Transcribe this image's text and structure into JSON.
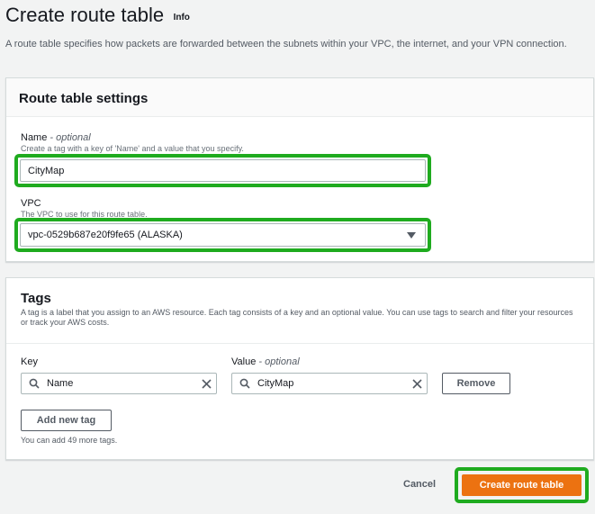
{
  "header": {
    "title": "Create route table",
    "info_label": "Info",
    "description": "A route table specifies how packets are forwarded between the subnets within your VPC, the internet, and your VPN connection."
  },
  "settings": {
    "title": "Route table settings",
    "name_label": "Name",
    "name_optional": " - optional",
    "name_hint": "Create a tag with a key of 'Name' and a value that you specify.",
    "name_value": "CityMap",
    "vpc_label": "VPC",
    "vpc_hint": "The VPC to use for this route table.",
    "vpc_value": "vpc-0529b687e20f9fe65 (ALASKA)"
  },
  "tags": {
    "title": "Tags",
    "description": "A tag is a label that you assign to an AWS resource. Each tag consists of a key and an optional value. You can use tags to search and filter your resources or track your AWS costs.",
    "key_label": "Key",
    "value_label": "Value",
    "value_optional": " - optional",
    "rows": [
      {
        "key": "Name",
        "value": "CityMap"
      }
    ],
    "remove_label": "Remove",
    "add_label": "Add new tag",
    "note": "You can add 49 more tags."
  },
  "footer": {
    "cancel_label": "Cancel",
    "create_label": "Create route table"
  },
  "colors": {
    "highlight": "#1fab1f",
    "primary": "#ec7211",
    "background": "#f2f3f3"
  }
}
